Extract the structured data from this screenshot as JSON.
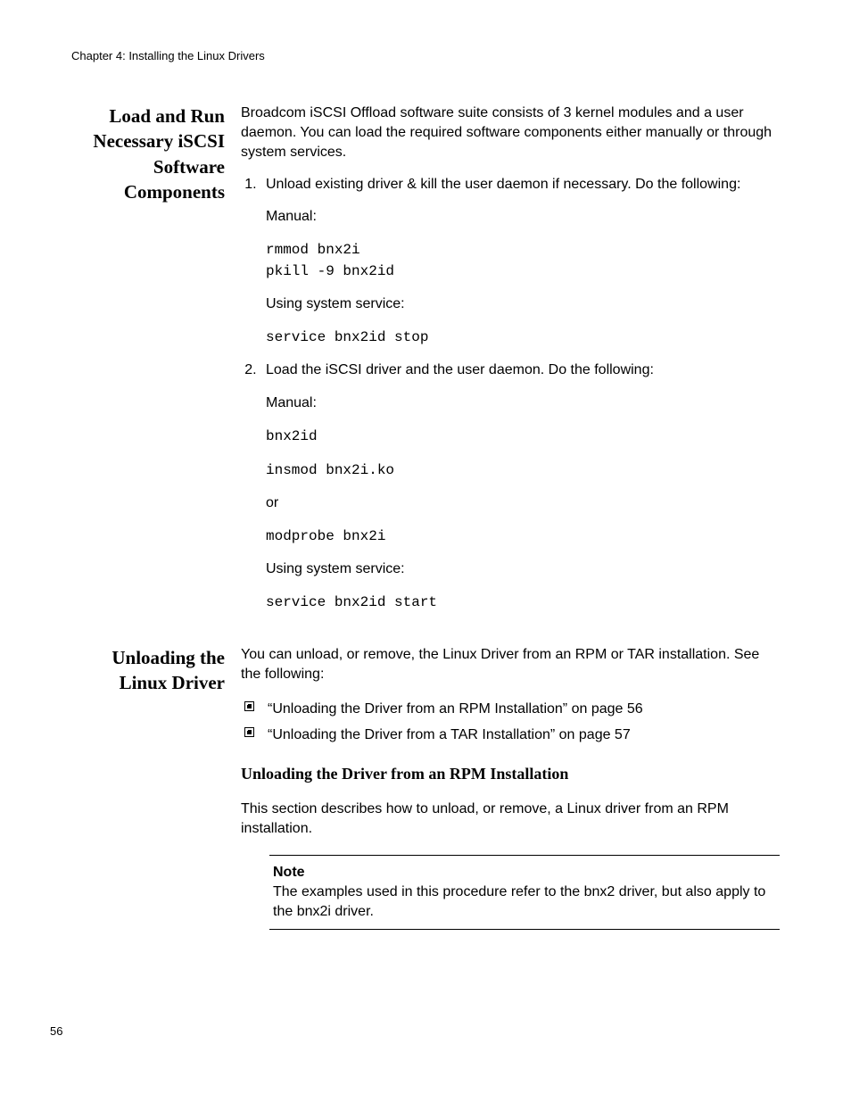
{
  "header": "Chapter 4: Installing the Linux Drivers",
  "page_number": "56",
  "section1": {
    "side_heading": "Load and Run Necessary iSCSI Software Components",
    "intro": "Broadcom iSCSI Offload software suite consists of 3 kernel modules and a user daemon. You can load the required software components either manually or through system services.",
    "step1": {
      "text": "Unload existing driver & kill the user daemon if necessary. Do the following:",
      "manual_label": "Manual:",
      "manual_code": "rmmod bnx2i\npkill -9 bnx2id",
      "service_label": "Using system service:",
      "service_code": "service bnx2id stop"
    },
    "step2": {
      "text": "Load the iSCSI driver and the user daemon. Do the following:",
      "manual_label": "Manual:",
      "code1": "bnx2id",
      "code2": "insmod bnx2i.ko",
      "or_label": "or",
      "code3": "modprobe bnx2i",
      "service_label": "Using system service:",
      "service_code": "service bnx2id start"
    }
  },
  "section2": {
    "side_heading": "Unloading the Linux Driver",
    "intro": "You can unload, or remove, the Linux Driver from an RPM or TAR installation. See the following:",
    "bullets": [
      "“Unloading the Driver from an RPM Installation” on page 56",
      "“Unloading the Driver from a TAR Installation” on page 57"
    ],
    "sub_heading": "Unloading the Driver from an RPM Installation",
    "sub_body": "This section describes how to unload, or remove, a Linux driver from an RPM installation.",
    "note_title": "Note",
    "note_body": "The examples used in this procedure refer to the bnx2 driver, but also apply to the bnx2i driver."
  }
}
